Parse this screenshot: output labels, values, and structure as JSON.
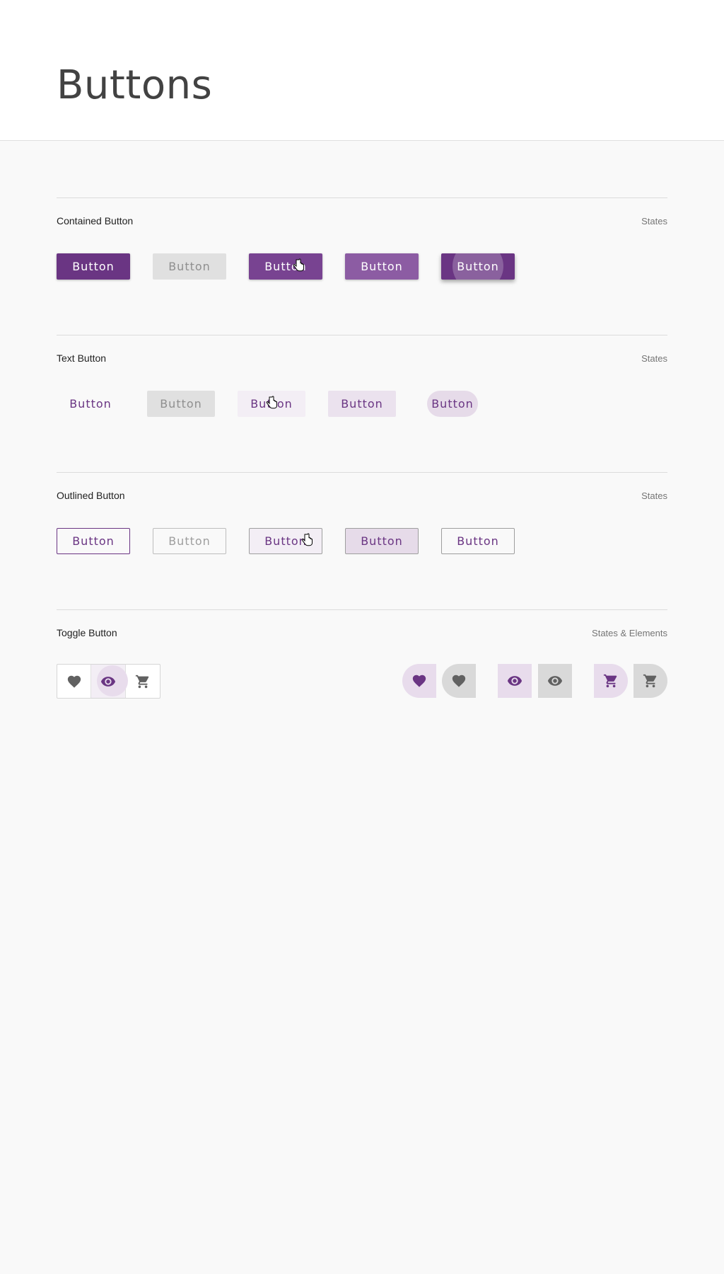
{
  "page": {
    "title": "Buttons"
  },
  "colors": {
    "primary": "#6a3583",
    "icon_gray": "#616161",
    "divider": "#dcdcdc"
  },
  "sections": {
    "contained": {
      "title": "Contained Button",
      "meta": "States",
      "buttons": [
        {
          "label": "Button",
          "state": "enabled"
        },
        {
          "label": "Button",
          "state": "disabled"
        },
        {
          "label": "Button",
          "state": "hover"
        },
        {
          "label": "Button",
          "state": "focused"
        },
        {
          "label": "Button",
          "state": "pressed"
        }
      ]
    },
    "text": {
      "title": "Text Button",
      "meta": "States",
      "buttons": [
        {
          "label": "Button",
          "state": "enabled"
        },
        {
          "label": "Button",
          "state": "disabled"
        },
        {
          "label": "Button",
          "state": "hover"
        },
        {
          "label": "Button",
          "state": "focused"
        },
        {
          "label": "Button",
          "state": "pressed"
        }
      ]
    },
    "outlined": {
      "title": "Outlined Button",
      "meta": "States",
      "buttons": [
        {
          "label": "Button",
          "state": "enabled"
        },
        {
          "label": "Button",
          "state": "disabled"
        },
        {
          "label": "Button",
          "state": "hover"
        },
        {
          "label": "Button",
          "state": "focused"
        },
        {
          "label": "Button",
          "state": "pressed"
        }
      ]
    },
    "toggle": {
      "title": "Toggle Button",
      "meta": "States & Elements",
      "group_icons": [
        "heart-icon",
        "eye-icon",
        "cart-icon"
      ],
      "state_icons": [
        "heart-icon",
        "heart-icon",
        "eye-icon",
        "eye-icon",
        "cart-icon",
        "cart-icon"
      ]
    }
  }
}
